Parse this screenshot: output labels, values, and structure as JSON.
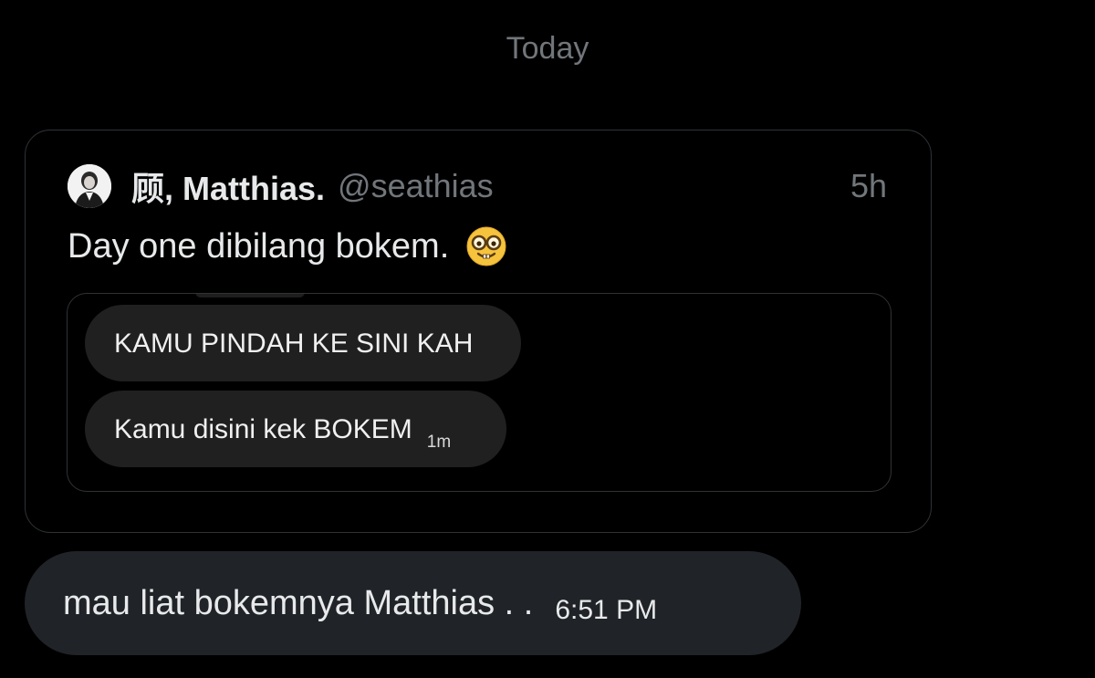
{
  "chat": {
    "date_divider": "Today"
  },
  "quoted_post": {
    "author_name": "顾, Matthias.",
    "handle": "@seathias",
    "time": "5h",
    "text": "Day one dibilang bokem.",
    "emoji": "nerd-face-icon",
    "media": {
      "messages": [
        {
          "text": "KAMU PINDAH KE SINI KAH"
        },
        {
          "text": "Kamu disini kek BOKEM",
          "time": "1m"
        }
      ]
    }
  },
  "reply": {
    "text": "mau liat bokemnya Matthias . .",
    "time": "6:51 PM"
  },
  "colors": {
    "background": "#000000",
    "muted_text": "#71767b",
    "bubble": "#202327",
    "border": "#2f3336"
  }
}
